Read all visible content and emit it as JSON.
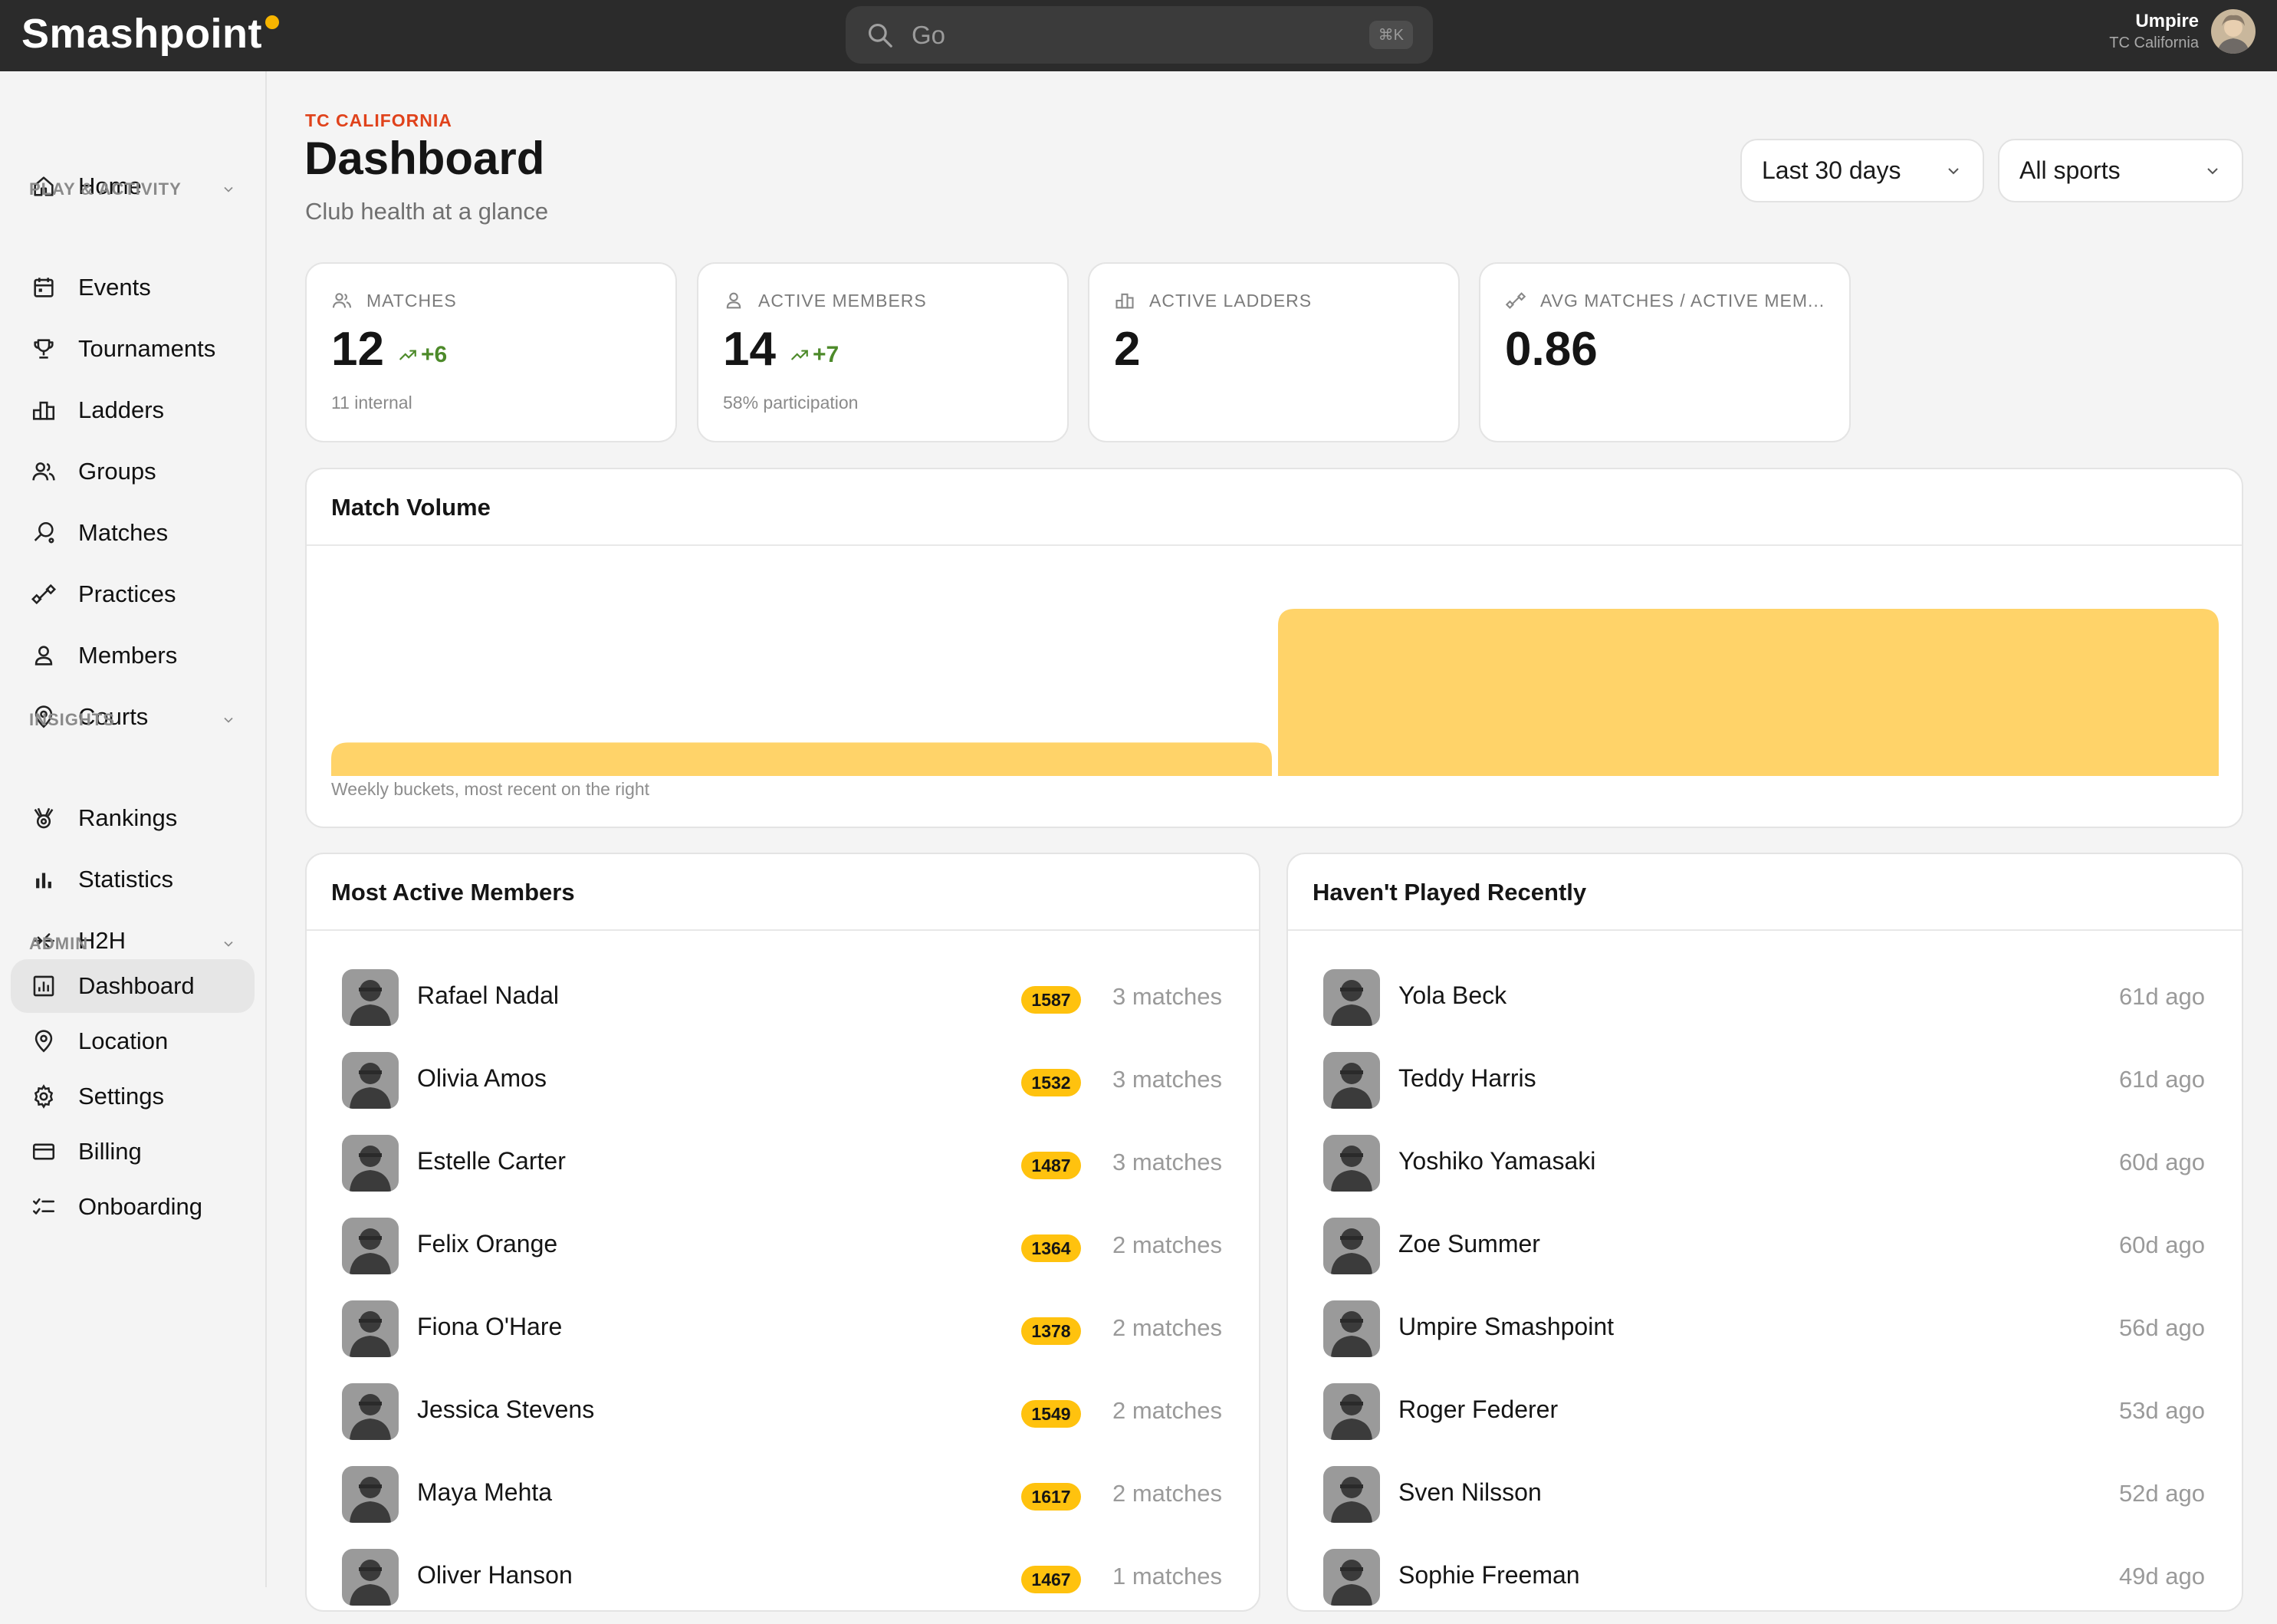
{
  "app": {
    "logo_text": "Smashpoint",
    "colors": {
      "accent": "#ffc20e",
      "chart_bar": "#ffd369",
      "eyebrow": "#e0421b",
      "topbar": "#2b2b2b",
      "trend": "#4d8a2a"
    }
  },
  "topbar": {
    "search_placeholder": "Go",
    "search_shortcut": "⌘K",
    "user_name": "Umpire",
    "user_club": "TC California"
  },
  "sidebar": {
    "home": "Home",
    "sections": {
      "play": "PLAY & ACTIVITY",
      "insights": "INSIGHTS",
      "admin": "ADMIN"
    },
    "play_items": [
      "Events",
      "Tournaments",
      "Ladders",
      "Groups",
      "Matches",
      "Practices",
      "Members",
      "Courts"
    ],
    "insights_items": [
      "Rankings",
      "Statistics",
      "H2H"
    ],
    "admin_items": [
      "Dashboard",
      "Location",
      "Settings",
      "Billing",
      "Onboarding"
    ],
    "active_item": "Dashboard"
  },
  "header": {
    "eyebrow": "TC CALIFORNIA",
    "title": "Dashboard",
    "subtitle": "Club health at a glance",
    "period_select": "Last 30 days",
    "sport_select": "All sports"
  },
  "stats": [
    {
      "label": "MATCHES",
      "value": "12",
      "trend": "+6",
      "sub": "11 internal",
      "icon": "users-icon"
    },
    {
      "label": "ACTIVE MEMBERS",
      "value": "14",
      "trend": "+7",
      "sub": "58% participation",
      "icon": "user-icon"
    },
    {
      "label": "ACTIVE LADDERS",
      "value": "2",
      "trend": "",
      "sub": "",
      "icon": "ladder-icon"
    },
    {
      "label": "AVG MATCHES / ACTIVE MEM...",
      "value": "0.86",
      "trend": "",
      "sub": "",
      "icon": "practice-icon"
    }
  ],
  "match_volume": {
    "title": "Match Volume",
    "caption": "Weekly buckets, most recent on the right"
  },
  "chart_data": {
    "type": "bar",
    "categories": [
      "",
      ""
    ],
    "values": [
      2,
      10
    ],
    "title": "Match Volume",
    "ylim": [
      0,
      10
    ],
    "grid": false
  },
  "most_active": {
    "title": "Most Active Members",
    "rows": [
      {
        "name": "Rafael Nadal",
        "rating": "1587",
        "meta": "3 matches"
      },
      {
        "name": "Olivia Amos",
        "rating": "1532",
        "meta": "3 matches"
      },
      {
        "name": "Estelle Carter",
        "rating": "1487",
        "meta": "3 matches"
      },
      {
        "name": "Felix Orange",
        "rating": "1364",
        "meta": "2 matches"
      },
      {
        "name": "Fiona O'Hare",
        "rating": "1378",
        "meta": "2 matches"
      },
      {
        "name": "Jessica Stevens",
        "rating": "1549",
        "meta": "2 matches"
      },
      {
        "name": "Maya Mehta",
        "rating": "1617",
        "meta": "2 matches"
      },
      {
        "name": "Oliver Hanson",
        "rating": "1467",
        "meta": "1 matches"
      }
    ]
  },
  "havent_played": {
    "title": "Haven't Played Recently",
    "rows": [
      {
        "name": "Yola Beck",
        "meta": "61d ago"
      },
      {
        "name": "Teddy Harris",
        "meta": "61d ago"
      },
      {
        "name": "Yoshiko Yamasaki",
        "meta": "60d ago"
      },
      {
        "name": "Zoe Summer",
        "meta": "60d ago"
      },
      {
        "name": "Umpire Smashpoint",
        "meta": "56d ago"
      },
      {
        "name": "Roger Federer",
        "meta": "53d ago"
      },
      {
        "name": "Sven Nilsson",
        "meta": "52d ago"
      },
      {
        "name": "Sophie Freeman",
        "meta": "49d ago"
      }
    ]
  }
}
